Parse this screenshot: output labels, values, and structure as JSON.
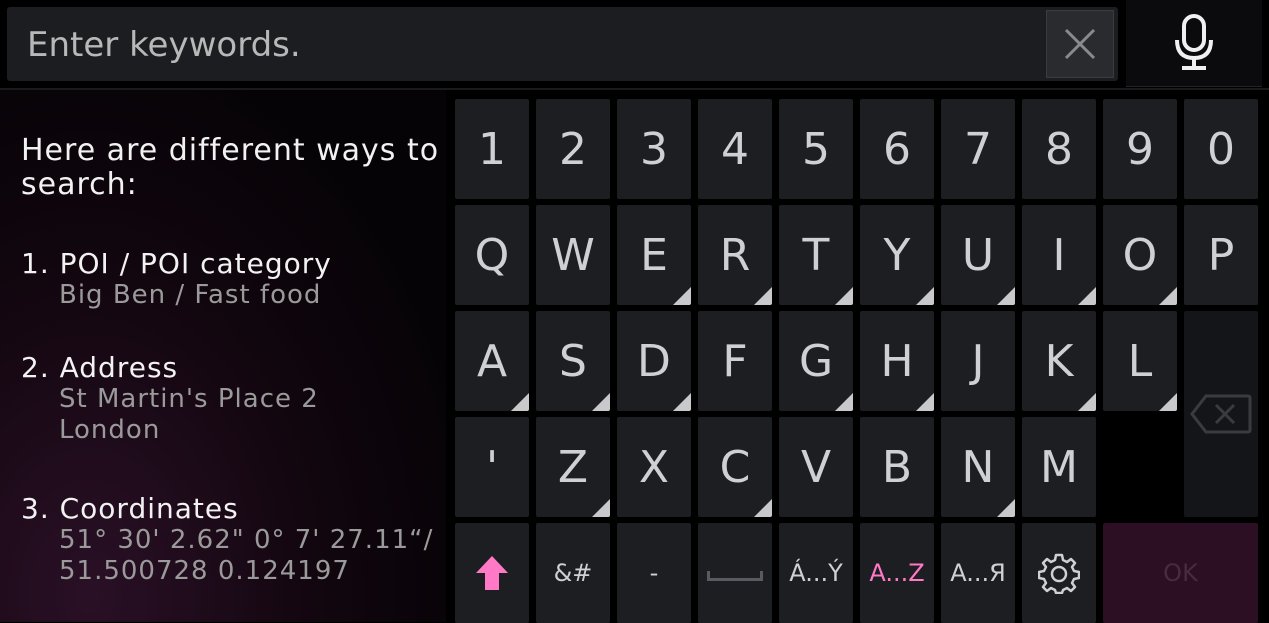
{
  "search": {
    "placeholder": "Enter keywords."
  },
  "help": {
    "title": "Here are different ways to search:",
    "methods": [
      {
        "heading": "1. POI / POI category",
        "example": "Big Ben / Fast food"
      },
      {
        "heading": "2. Address",
        "example": "St Martin's Place 2\nLondon"
      },
      {
        "heading": "3. Coordinates",
        "example": "51° 30' 2.62\" 0° 7' 27.11“/\n51.500728 0.124197"
      }
    ]
  },
  "keyboard": {
    "row1": [
      "1",
      "2",
      "3",
      "4",
      "5",
      "6",
      "7",
      "8",
      "9",
      "0"
    ],
    "row2": [
      "Q",
      "W",
      "E",
      "R",
      "T",
      "Y",
      "U",
      "I",
      "O",
      "P"
    ],
    "row3": [
      "A",
      "S",
      "D",
      "F",
      "G",
      "H",
      "J",
      "K",
      "L"
    ],
    "row4": [
      "'",
      "Z",
      "X",
      "C",
      "V",
      "B",
      "N",
      "M"
    ],
    "bottom": {
      "symbols": "&#",
      "dash": "-",
      "accented": "Á...Ý",
      "latin": "A...Z",
      "cyrillic": "A...Я",
      "ok": "OK"
    }
  },
  "colors": {
    "accent_pink": "#ff79c7",
    "ok_disabled": "#2c0f22"
  },
  "icons": {
    "clear": "close-icon",
    "mic": "microphone-icon",
    "shift": "shift-arrow-icon",
    "backspace": "backspace-icon",
    "settings": "gear-icon"
  }
}
